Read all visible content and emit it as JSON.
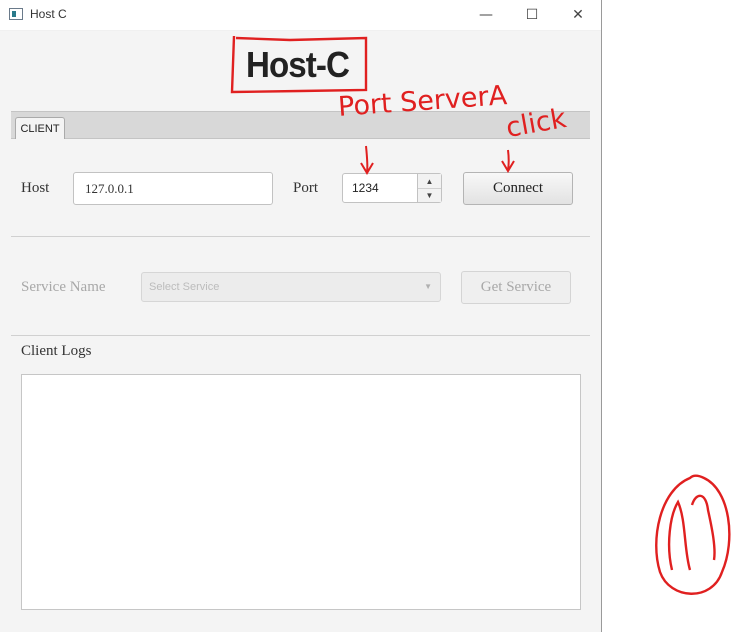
{
  "window": {
    "title": "Host C",
    "controls": {
      "minimize": "—",
      "maximize": "☐",
      "close": "✕"
    }
  },
  "heading": "Host-C",
  "tabs": [
    {
      "label": "CLIENT",
      "selected": true
    }
  ],
  "connection": {
    "host_label": "Host",
    "host_value": "127.0.0.1",
    "port_label": "Port",
    "port_value": "1234",
    "connect_label": "Connect"
  },
  "service": {
    "label": "Service Name",
    "placeholder": "Select Service",
    "button_label": "Get Service",
    "enabled": false
  },
  "logs": {
    "label": "Client Logs",
    "content": ""
  },
  "annotations": {
    "port_note": "Port ServerA",
    "connect_note": "click",
    "color": "#e02020"
  },
  "colors": {
    "accent": "#e02020",
    "window_bg": "#f4f4f4"
  }
}
